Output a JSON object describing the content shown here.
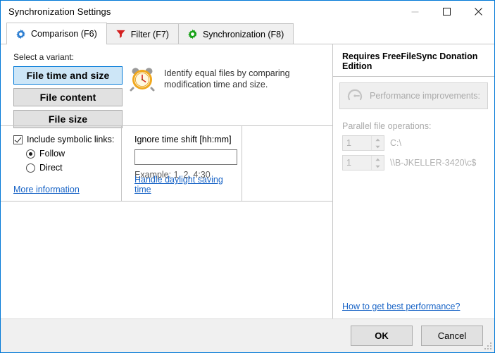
{
  "window": {
    "title": "Synchronization Settings",
    "controls": {
      "minimize": "minimize-icon",
      "maximize": "maximize-icon",
      "close": "close-icon"
    }
  },
  "tabs": [
    {
      "label": "Comparison (F6)",
      "icon": "blue-gear-icon",
      "active": true
    },
    {
      "label": "Filter (F7)",
      "icon": "red-funnel-icon",
      "active": false
    },
    {
      "label": "Synchronization (F8)",
      "icon": "green-gear-icon",
      "active": false
    }
  ],
  "comparison": {
    "select_variant_label": "Select a variant:",
    "variants": [
      {
        "label": "File time and size",
        "selected": true
      },
      {
        "label": "File content",
        "selected": false
      },
      {
        "label": "File size",
        "selected": false
      }
    ],
    "description": {
      "icon": "alarm-clock-icon",
      "line1": "Identify equal files by comparing",
      "line2": "modification time and size."
    },
    "symlinks": {
      "checkbox_label": "Include symbolic links:",
      "checked": true,
      "options": [
        {
          "label": "Follow",
          "selected": true
        },
        {
          "label": "Direct",
          "selected": false
        }
      ],
      "link": "More information"
    },
    "time_shift": {
      "label": "Ignore time shift [hh:mm]",
      "value": "",
      "placeholder": "",
      "example": "Example:  1, 2, 4:30",
      "link": "Handle daylight saving time"
    }
  },
  "donation_panel": {
    "title": "Requires FreeFileSync Donation Edition",
    "performance_header": {
      "icon": "gauge-icon",
      "label": "Performance improvements:"
    },
    "parallel_label": "Parallel file operations:",
    "rows": [
      {
        "value": "1",
        "path": "C:\\"
      },
      {
        "value": "1",
        "path": "\\\\B-JKELLER-3420\\c$"
      }
    ],
    "link": "How to get best performance?"
  },
  "footer": {
    "ok_label": "OK",
    "cancel_label": "Cancel"
  },
  "colors": {
    "accent": "#0078d7",
    "selected_button_bg": "#cde6f7",
    "link": "#1763c6",
    "disabled_text": "#b0b0b0"
  }
}
